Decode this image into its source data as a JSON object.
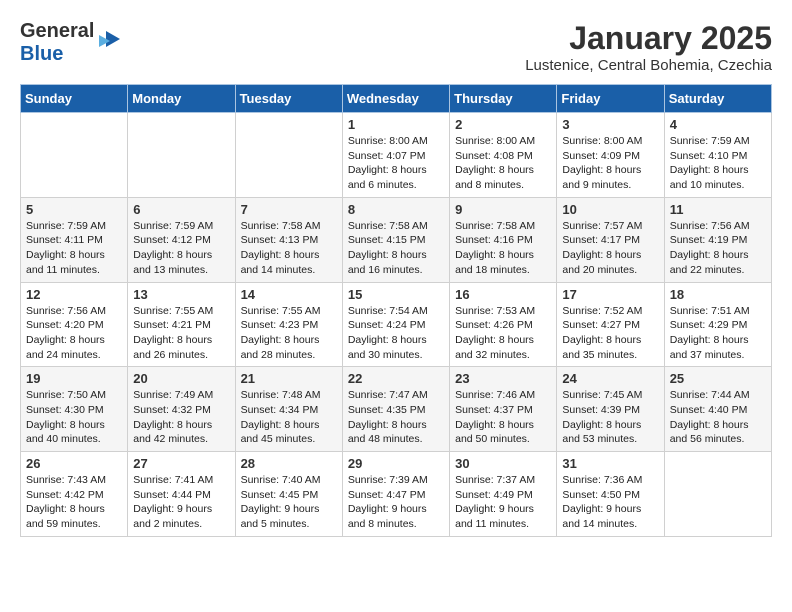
{
  "header": {
    "logo_line1": "General",
    "logo_line2": "Blue",
    "month": "January 2025",
    "location": "Lustenice, Central Bohemia, Czechia"
  },
  "weekdays": [
    "Sunday",
    "Monday",
    "Tuesday",
    "Wednesday",
    "Thursday",
    "Friday",
    "Saturday"
  ],
  "weeks": [
    [
      {
        "day": "",
        "info": ""
      },
      {
        "day": "",
        "info": ""
      },
      {
        "day": "",
        "info": ""
      },
      {
        "day": "1",
        "info": "Sunrise: 8:00 AM\nSunset: 4:07 PM\nDaylight: 8 hours and 6 minutes."
      },
      {
        "day": "2",
        "info": "Sunrise: 8:00 AM\nSunset: 4:08 PM\nDaylight: 8 hours and 8 minutes."
      },
      {
        "day": "3",
        "info": "Sunrise: 8:00 AM\nSunset: 4:09 PM\nDaylight: 8 hours and 9 minutes."
      },
      {
        "day": "4",
        "info": "Sunrise: 7:59 AM\nSunset: 4:10 PM\nDaylight: 8 hours and 10 minutes."
      }
    ],
    [
      {
        "day": "5",
        "info": "Sunrise: 7:59 AM\nSunset: 4:11 PM\nDaylight: 8 hours and 11 minutes."
      },
      {
        "day": "6",
        "info": "Sunrise: 7:59 AM\nSunset: 4:12 PM\nDaylight: 8 hours and 13 minutes."
      },
      {
        "day": "7",
        "info": "Sunrise: 7:58 AM\nSunset: 4:13 PM\nDaylight: 8 hours and 14 minutes."
      },
      {
        "day": "8",
        "info": "Sunrise: 7:58 AM\nSunset: 4:15 PM\nDaylight: 8 hours and 16 minutes."
      },
      {
        "day": "9",
        "info": "Sunrise: 7:58 AM\nSunset: 4:16 PM\nDaylight: 8 hours and 18 minutes."
      },
      {
        "day": "10",
        "info": "Sunrise: 7:57 AM\nSunset: 4:17 PM\nDaylight: 8 hours and 20 minutes."
      },
      {
        "day": "11",
        "info": "Sunrise: 7:56 AM\nSunset: 4:19 PM\nDaylight: 8 hours and 22 minutes."
      }
    ],
    [
      {
        "day": "12",
        "info": "Sunrise: 7:56 AM\nSunset: 4:20 PM\nDaylight: 8 hours and 24 minutes."
      },
      {
        "day": "13",
        "info": "Sunrise: 7:55 AM\nSunset: 4:21 PM\nDaylight: 8 hours and 26 minutes."
      },
      {
        "day": "14",
        "info": "Sunrise: 7:55 AM\nSunset: 4:23 PM\nDaylight: 8 hours and 28 minutes."
      },
      {
        "day": "15",
        "info": "Sunrise: 7:54 AM\nSunset: 4:24 PM\nDaylight: 8 hours and 30 minutes."
      },
      {
        "day": "16",
        "info": "Sunrise: 7:53 AM\nSunset: 4:26 PM\nDaylight: 8 hours and 32 minutes."
      },
      {
        "day": "17",
        "info": "Sunrise: 7:52 AM\nSunset: 4:27 PM\nDaylight: 8 hours and 35 minutes."
      },
      {
        "day": "18",
        "info": "Sunrise: 7:51 AM\nSunset: 4:29 PM\nDaylight: 8 hours and 37 minutes."
      }
    ],
    [
      {
        "day": "19",
        "info": "Sunrise: 7:50 AM\nSunset: 4:30 PM\nDaylight: 8 hours and 40 minutes."
      },
      {
        "day": "20",
        "info": "Sunrise: 7:49 AM\nSunset: 4:32 PM\nDaylight: 8 hours and 42 minutes."
      },
      {
        "day": "21",
        "info": "Sunrise: 7:48 AM\nSunset: 4:34 PM\nDaylight: 8 hours and 45 minutes."
      },
      {
        "day": "22",
        "info": "Sunrise: 7:47 AM\nSunset: 4:35 PM\nDaylight: 8 hours and 48 minutes."
      },
      {
        "day": "23",
        "info": "Sunrise: 7:46 AM\nSunset: 4:37 PM\nDaylight: 8 hours and 50 minutes."
      },
      {
        "day": "24",
        "info": "Sunrise: 7:45 AM\nSunset: 4:39 PM\nDaylight: 8 hours and 53 minutes."
      },
      {
        "day": "25",
        "info": "Sunrise: 7:44 AM\nSunset: 4:40 PM\nDaylight: 8 hours and 56 minutes."
      }
    ],
    [
      {
        "day": "26",
        "info": "Sunrise: 7:43 AM\nSunset: 4:42 PM\nDaylight: 8 hours and 59 minutes."
      },
      {
        "day": "27",
        "info": "Sunrise: 7:41 AM\nSunset: 4:44 PM\nDaylight: 9 hours and 2 minutes."
      },
      {
        "day": "28",
        "info": "Sunrise: 7:40 AM\nSunset: 4:45 PM\nDaylight: 9 hours and 5 minutes."
      },
      {
        "day": "29",
        "info": "Sunrise: 7:39 AM\nSunset: 4:47 PM\nDaylight: 9 hours and 8 minutes."
      },
      {
        "day": "30",
        "info": "Sunrise: 7:37 AM\nSunset: 4:49 PM\nDaylight: 9 hours and 11 minutes."
      },
      {
        "day": "31",
        "info": "Sunrise: 7:36 AM\nSunset: 4:50 PM\nDaylight: 9 hours and 14 minutes."
      },
      {
        "day": "",
        "info": ""
      }
    ]
  ]
}
